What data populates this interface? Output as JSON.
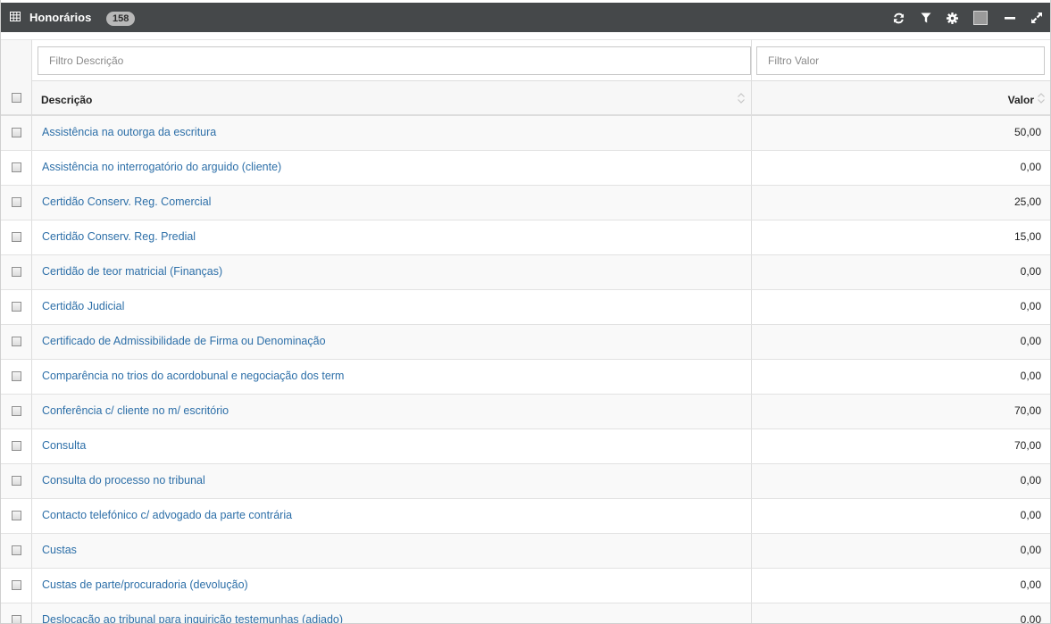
{
  "panel": {
    "title": "Honorários",
    "count": "158",
    "color_box": "#9a9a9a",
    "toolbar_icons": [
      "refresh-icon",
      "filter-icon",
      "gear-icon",
      "minimize-icon",
      "expand-icon"
    ]
  },
  "filters": {
    "descricao_placeholder": "Filtro Descrição",
    "valor_placeholder": "Filtro Valor"
  },
  "columns": {
    "descricao": "Descrição",
    "valor": "Valor"
  },
  "rows": [
    {
      "descricao": "Assistência na outorga da escritura",
      "valor": "50,00"
    },
    {
      "descricao": "Assistência no interrogatório do arguido (cliente)",
      "valor": "0,00"
    },
    {
      "descricao": "Certidão Conserv. Reg. Comercial",
      "valor": "25,00"
    },
    {
      "descricao": "Certidão Conserv. Reg. Predial",
      "valor": "15,00"
    },
    {
      "descricao": "Certidão de teor matricial (Finanças)",
      "valor": "0,00"
    },
    {
      "descricao": "Certidão Judicial",
      "valor": "0,00"
    },
    {
      "descricao": "Certificado de Admissibilidade de Firma ou Denominação",
      "valor": "0,00"
    },
    {
      "descricao": "Comparência no trios do acordobunal e negociação dos term",
      "valor": "0,00"
    },
    {
      "descricao": "Conferência c/ cliente no m/ escritório",
      "valor": "70,00"
    },
    {
      "descricao": "Consulta",
      "valor": "70,00"
    },
    {
      "descricao": "Consulta do processo no tribunal",
      "valor": "0,00"
    },
    {
      "descricao": "Contacto telefónico c/ advogado da parte contrária",
      "valor": "0,00"
    },
    {
      "descricao": "Custas",
      "valor": "0,00"
    },
    {
      "descricao": "Custas de parte/procuradoria (devolução)",
      "valor": "0,00"
    },
    {
      "descricao": "Deslocação ao tribunal para inquirição testemunhas (adiado)",
      "valor": "0,00"
    }
  ]
}
